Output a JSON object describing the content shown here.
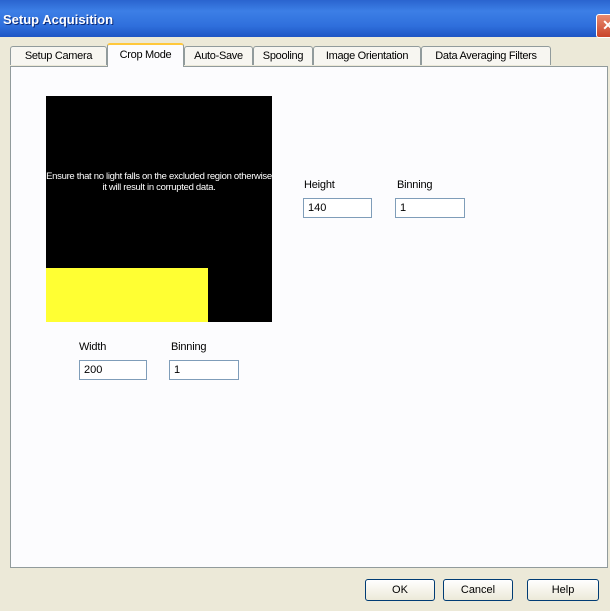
{
  "window": {
    "title": "Setup Acquisition",
    "close_glyph": "✕"
  },
  "tabs": [
    {
      "label": "Setup Camera"
    },
    {
      "label": "Crop Mode"
    },
    {
      "label": "Auto-Save"
    },
    {
      "label": "Spooling"
    },
    {
      "label": "Image Orientation"
    },
    {
      "label": "Data Averaging Filters"
    }
  ],
  "crop": {
    "warning": "Ensure that no light falls on the excluded region otherwise it will result in corrupted data.",
    "height_label": "Height",
    "height_value": "140",
    "height_binning_label": "Binning",
    "height_binning_value": "1",
    "width_label": "Width",
    "width_value": "200",
    "width_binning_label": "Binning",
    "width_binning_value": "1",
    "roi_color": "#ffff33"
  },
  "buttons": {
    "ok": "OK",
    "cancel": "Cancel",
    "help": "Help"
  }
}
